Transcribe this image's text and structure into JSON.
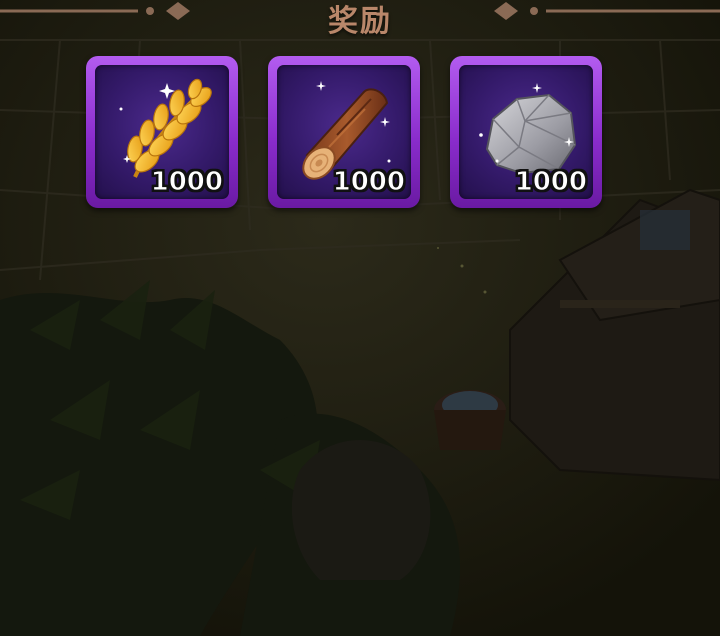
{
  "header": {
    "title": "奖励"
  },
  "rewards": [
    {
      "icon": "wheat-icon",
      "count": "1000"
    },
    {
      "icon": "wood-log-icon",
      "count": "1000"
    },
    {
      "icon": "stone-icon",
      "count": "1000"
    }
  ],
  "colors": {
    "title": "#b9876a",
    "tile_border": "#a04ae0",
    "tile_inner": "#341a6a",
    "count_text": "#ffffff"
  }
}
